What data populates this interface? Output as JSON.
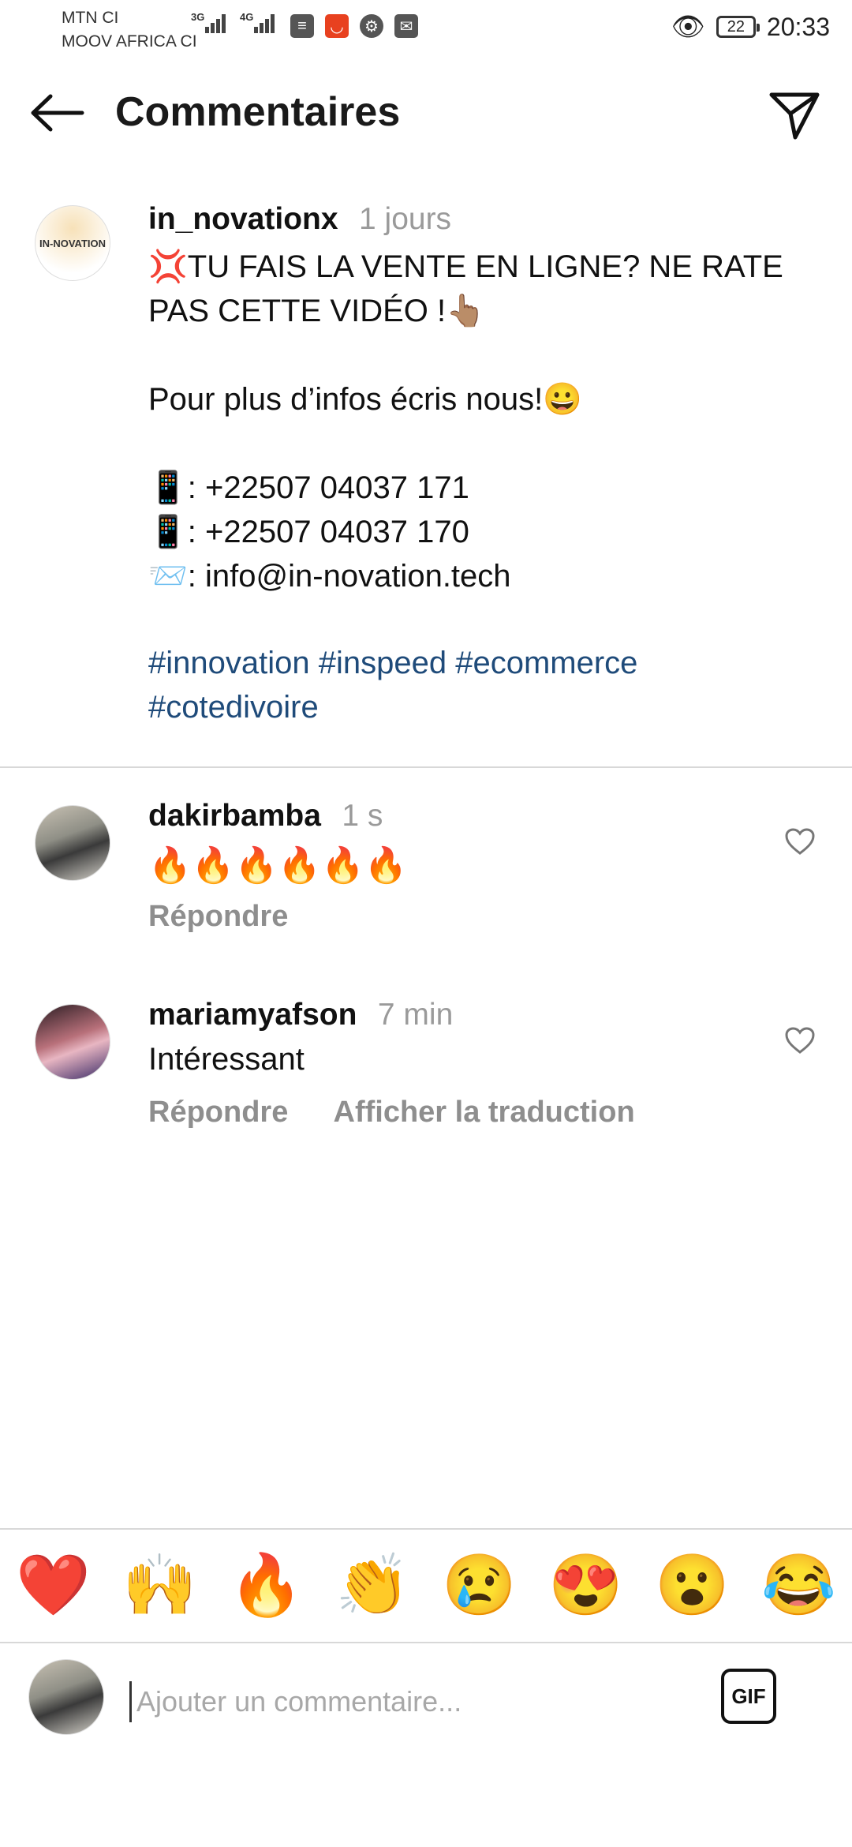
{
  "status_bar": {
    "carrier1": "MTN CI",
    "carrier2": "MOOV AFRICA CI",
    "net1": "3G",
    "net2": "4G",
    "battery": "22",
    "time": "20:33"
  },
  "header": {
    "title": "Commentaires"
  },
  "post": {
    "username": "in_novationx",
    "time": "1 jours",
    "avatar_text": "IN-NOVATION",
    "caption": "💢TU FAIS LA VENTE EN LIGNE? NE RATE PAS CETTE VIDÉO !👆🏽\n\nPour plus d’infos écris nous!😀\n\n📱: +22507 04037 171\n📱: +22507 04037 170\n📨: info@in-novation.tech",
    "hashtags": "#innovation #inspeed #ecommerce #cotedivoire"
  },
  "comments": [
    {
      "username": "dakirbamba",
      "time": "1 s",
      "text": "🔥🔥🔥🔥🔥🔥",
      "reply": "Répondre"
    },
    {
      "username": "mariamyafson",
      "time": "7 min",
      "text": "Intéressant",
      "reply": "Répondre",
      "translate": "Afficher la traduction"
    }
  ],
  "emoji_bar": [
    "❤️",
    "🙌",
    "🔥",
    "👏",
    "😢",
    "😍",
    "😮",
    "😂"
  ],
  "composer": {
    "placeholder": "Ajouter un commentaire...",
    "gif_label": "GIF"
  },
  "colors": {
    "hashtag": "#1f4b7a",
    "muted": "#8e8e8e"
  }
}
